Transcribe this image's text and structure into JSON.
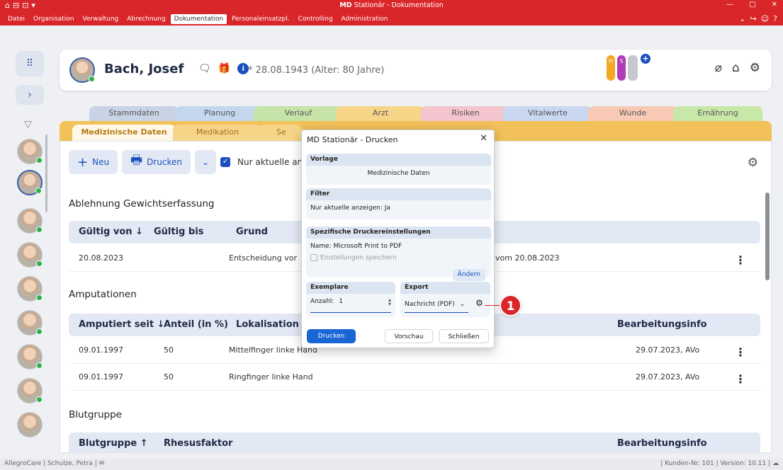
{
  "window": {
    "title_prefix": "MD",
    "title_rest": " Stationär - Dokumentation",
    "controls": [
      "—",
      "□",
      "✕"
    ]
  },
  "menu": {
    "items": [
      "Datei",
      "Organisation",
      "Verwaltung",
      "Abrechnung",
      "Dokumentation",
      "Personaleinsatzpl.",
      "Controlling",
      "Administration"
    ],
    "active_index": 4
  },
  "patient": {
    "name": "Bach, Josef",
    "dob": "* 28.08.1943 (Alter: 80 Jahre)",
    "hs_h": "H",
    "hs_s": "S"
  },
  "tabs_row1": [
    "Stammdaten",
    "Planung",
    "Verlauf",
    "Arzt",
    "Risiken",
    "Vitalwerte",
    "Wunde",
    "Ernährung"
  ],
  "tabs_row2": [
    "Medizinische Daten",
    "Medikation",
    "Se"
  ],
  "toolbar": {
    "new_label": "Neu",
    "print_label": "Drucken",
    "current_only_label": "Nur aktuelle anze"
  },
  "sections": {
    "ablehnung": {
      "title": "Ablehnung Gewichtserfassung",
      "headers": [
        "Gültig von ↓",
        "Gültig bis",
        "Grund"
      ],
      "row": [
        "20.08.2023",
        "Entscheidung vor",
        "vom 20.08.2023"
      ]
    },
    "amputationen": {
      "title": "Amputationen",
      "headers": [
        "Amputiert seit ↓",
        "Anteil (in %)",
        "Lokalisation",
        "Bearbeitungsinfo"
      ],
      "rows": [
        [
          "09.01.1997",
          "50",
          "Mittelfinger linke Hand",
          "29.07.2023, AVo"
        ],
        [
          "09.01.1997",
          "50",
          "Ringfinger linke Hand",
          "29.07.2023, AVo"
        ]
      ]
    },
    "blutgruppe": {
      "title": "Blutgruppe",
      "headers": [
        "Blutgruppe ↑",
        "Rhesusfaktor",
        "Bearbeitungsinfo"
      ]
    }
  },
  "dialog": {
    "title": "MD Stationär - Drucken",
    "vorlage_label": "Vorlage",
    "vorlage_value": "Medizinische Daten",
    "filter_label": "Filter",
    "filter_value": "Nur aktuelle anzeigen: Ja",
    "printer_label": "Spezifische Druckereinstellungen",
    "printer_name": "Name:  Microsoft Print to PDF",
    "save_settings_label": "Einstellungen speichern",
    "change_label": "Ändern",
    "copies_label": "Exemplare",
    "copies_field_label": "Anzahl:",
    "copies_value": "1",
    "export_label": "Export",
    "export_value": "Nachricht (PDF)",
    "print_button": "Drucken",
    "preview_button": "Vorschau",
    "close_button": "Schließen"
  },
  "callout": "1",
  "status": {
    "left": "AllegroCare | Schulze, Petra |",
    "right": "| Kunden-Nr. 101 | Version: 10.11 |"
  },
  "colors": {
    "brand_red": "#d9262a",
    "accent_blue": "#1b4fbf",
    "tab_yellow": "#f2c15a"
  }
}
